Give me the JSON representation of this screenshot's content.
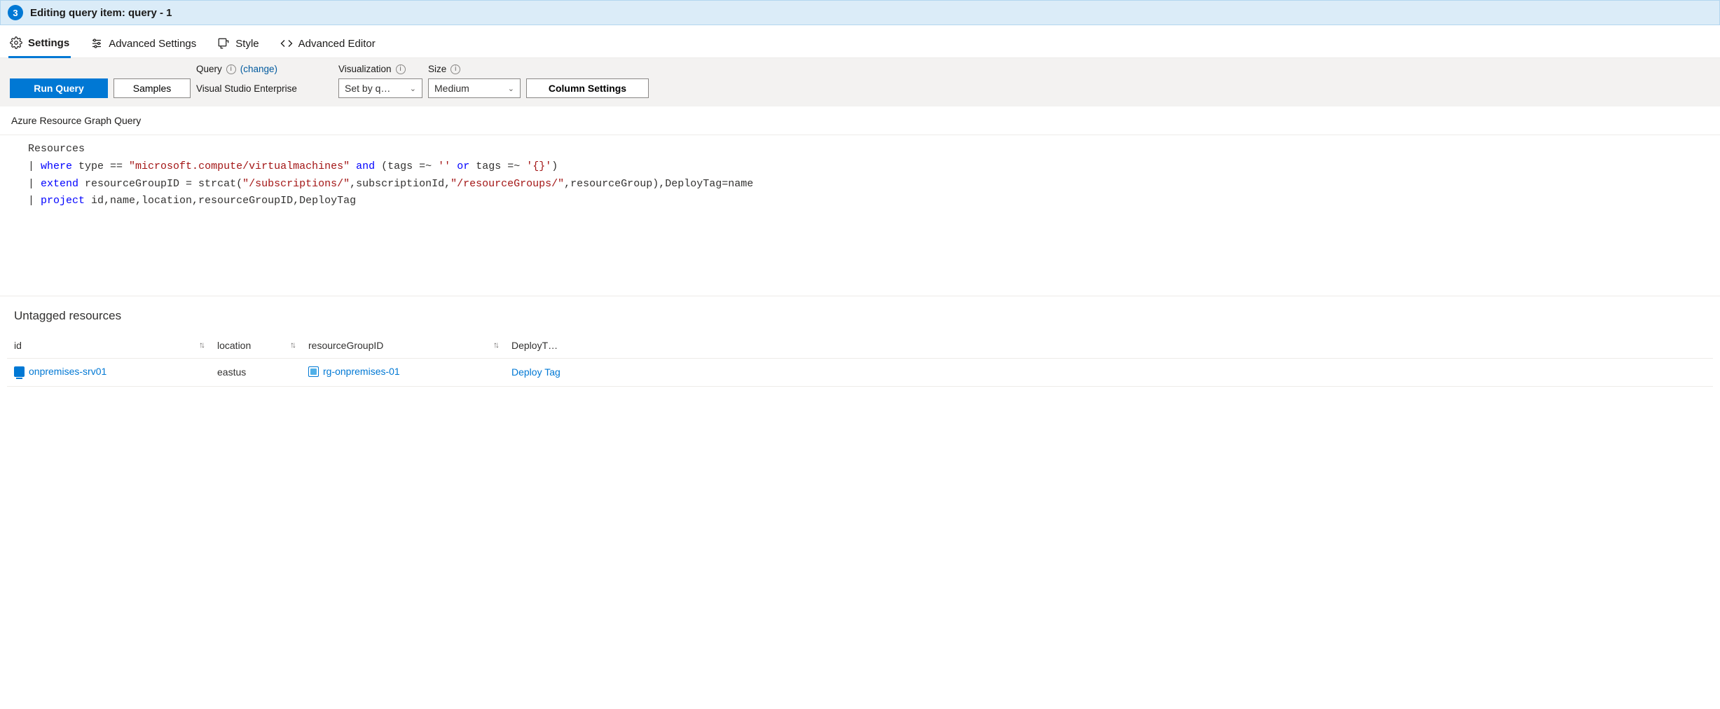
{
  "header": {
    "step": "3",
    "title": "Editing query item: query - 1"
  },
  "tabs": {
    "settings": "Settings",
    "advanced_settings": "Advanced Settings",
    "style": "Style",
    "advanced_editor": "Advanced Editor"
  },
  "toolbar": {
    "run_query": "Run Query",
    "samples": "Samples",
    "query_label": "Query",
    "change": "(change)",
    "query_value": "Visual Studio Enterprise",
    "visualization_label": "Visualization",
    "visualization_value": "Set by q…",
    "size_label": "Size",
    "size_value": "Medium",
    "column_settings": "Column Settings"
  },
  "section": {
    "query_type": "Azure Resource Graph Query"
  },
  "code": {
    "l1": "Resources",
    "l2_kw": "where",
    "l2_rest_a": " type == ",
    "l2_str1": "\"microsoft.compute/virtualmachines\"",
    "l2_rest_b": " ",
    "l2_kw2": "and",
    "l2_rest_c": " (tags =~ ",
    "l2_str2": "''",
    "l2_rest_d": " ",
    "l2_kw3": "or",
    "l2_rest_e": " tags =~ ",
    "l2_str3": "'{}'",
    "l2_rest_f": ")",
    "l3_kw": "extend",
    "l3_rest_a": " resourceGroupID = strcat(",
    "l3_str1": "\"/subscriptions/\"",
    "l3_rest_b": ",subscriptionId,",
    "l3_str2": "\"/resourceGroups/\"",
    "l3_rest_c": ",resourceGroup),DeployTag=name",
    "l4_kw": "project",
    "l4_rest": " id,name,location,resourceGroupID,DeployTag"
  },
  "results": {
    "title": "Untagged resources",
    "headers": {
      "id": "id",
      "location": "location",
      "rgid": "resourceGroupID",
      "deploy": "DeployT…"
    },
    "rows": [
      {
        "id": "onpremises-srv01",
        "location": "eastus",
        "rgid": "rg-onpremises-01",
        "deploy": "Deploy Tag"
      }
    ]
  }
}
